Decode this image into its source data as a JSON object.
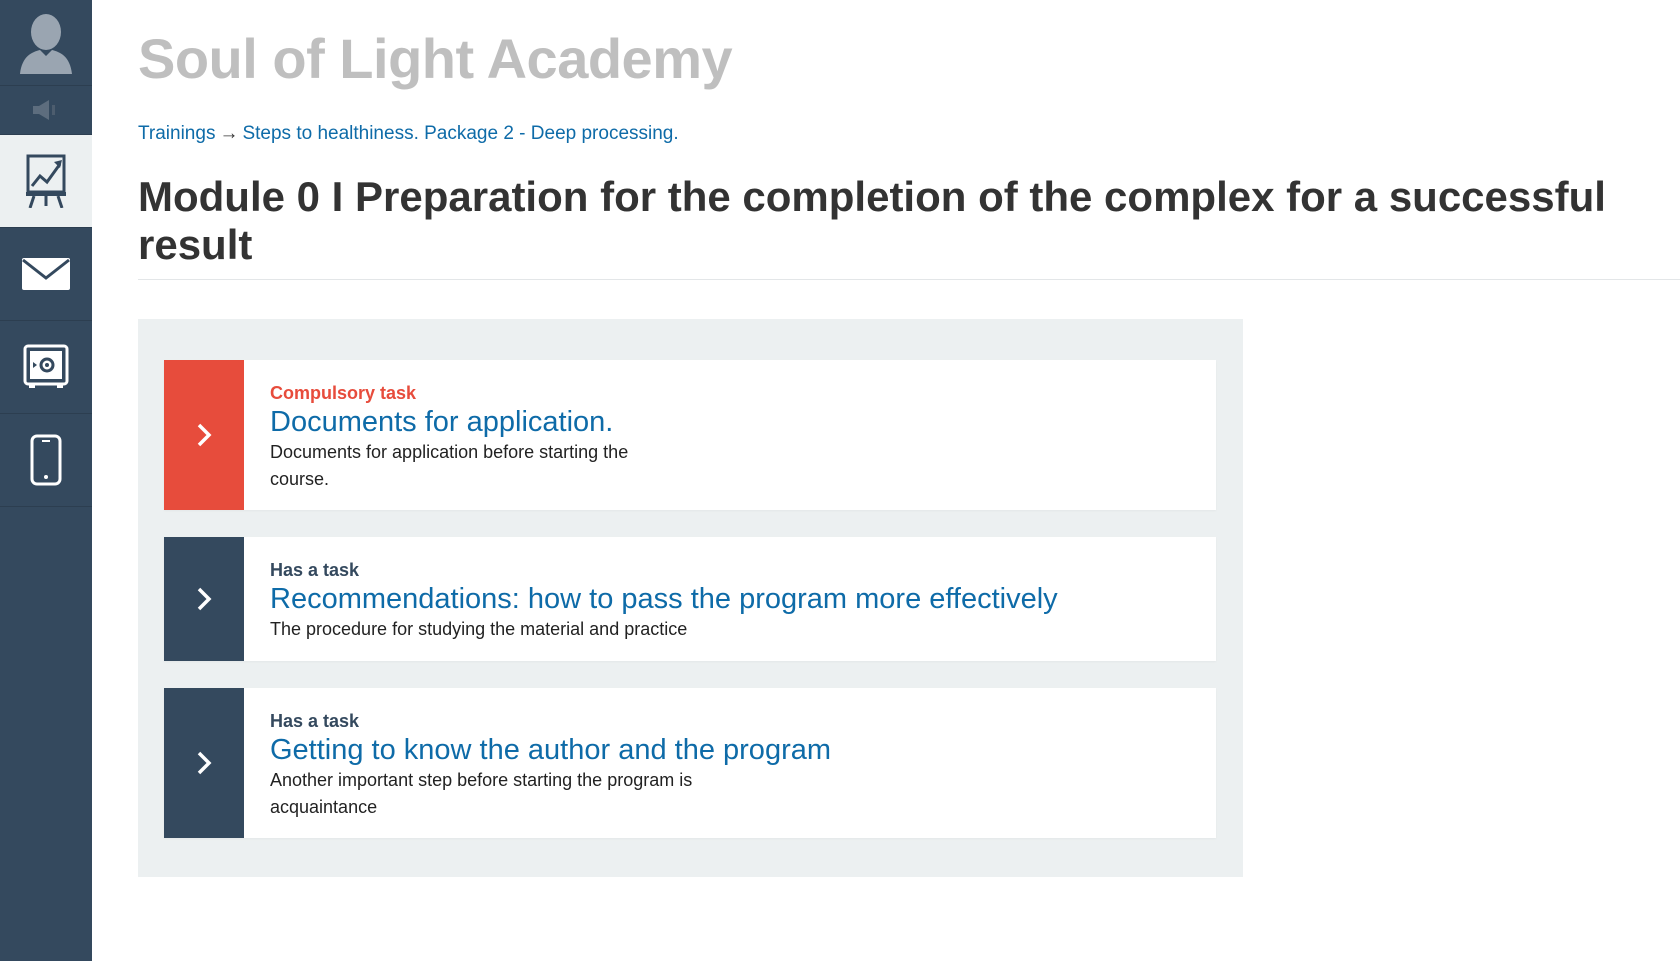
{
  "app": {
    "title": "Soul of Light Academy"
  },
  "breadcrumb": {
    "items": [
      "Trainings",
      "Steps to healthiness. Package 2 - Deep processing."
    ],
    "separator": "→"
  },
  "module": {
    "title": "Module 0 I Preparation for the completion of the complex for a successful result"
  },
  "sidebar": {
    "items": [
      {
        "icon": "user-avatar-icon"
      },
      {
        "icon": "speaker-icon"
      },
      {
        "icon": "presentation-chart-icon",
        "active": true
      },
      {
        "icon": "envelope-icon"
      },
      {
        "icon": "safe-icon"
      },
      {
        "icon": "smartphone-icon"
      }
    ]
  },
  "tasks": [
    {
      "tag": "Compulsory task",
      "title": "Documents for application.",
      "description": "Documents for application before starting the course.",
      "accent": "#e74c3c"
    },
    {
      "tag": "Has a task",
      "title": "Recommendations: how to pass the program more effectively",
      "description": "The procedure for studying the material and practice",
      "accent": "#34495e"
    },
    {
      "tag": "Has a task",
      "title": "Getting to know the author and the program",
      "description": "Another important step before starting the program is acquaintance",
      "accent": "#34495e"
    }
  ],
  "colors": {
    "sidebar": "#34495e",
    "link": "#0e6ba8",
    "compulsory": "#e74c3c",
    "panel": "#ecf0f1"
  }
}
